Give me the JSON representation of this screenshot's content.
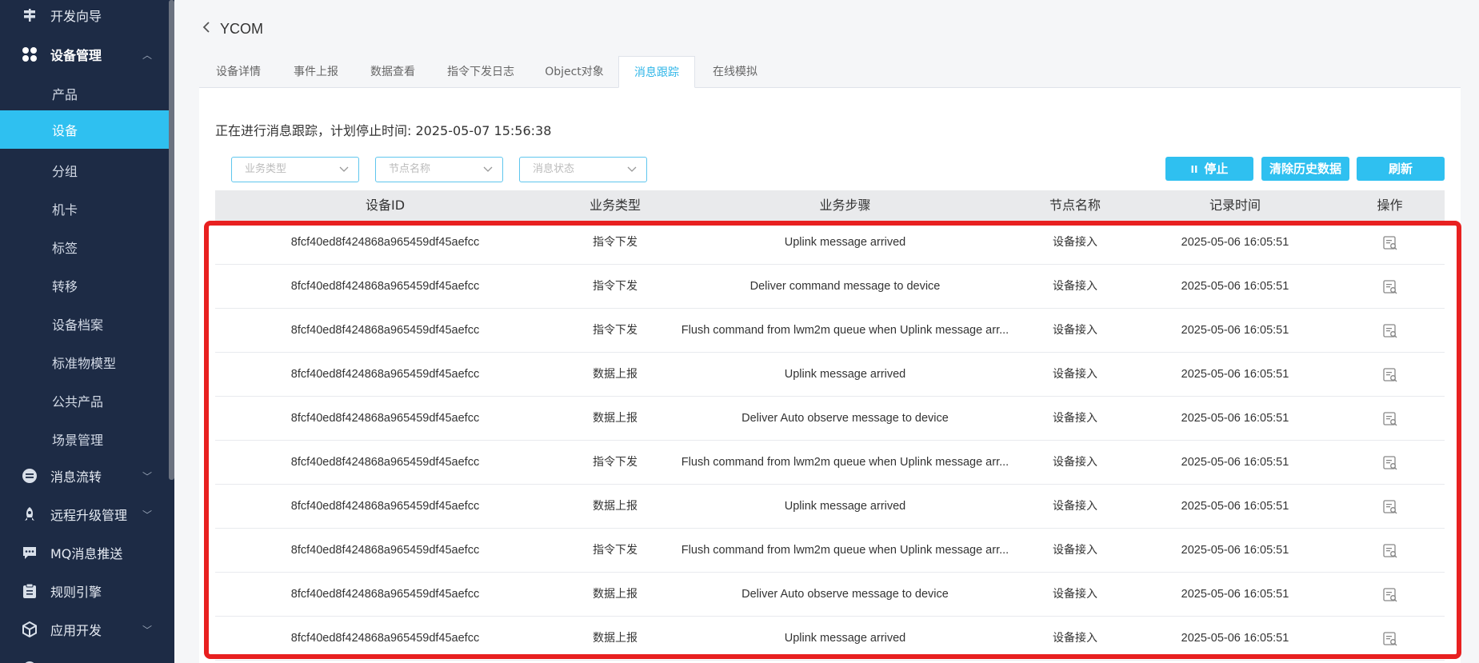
{
  "sidebar": {
    "top_items": [
      {
        "label": "开发向导",
        "icon": "signpost-icon"
      },
      {
        "label": "设备管理",
        "icon": "grid-icon",
        "expanded": true
      }
    ],
    "sub_items": [
      {
        "label": "产品"
      },
      {
        "label": "设备",
        "active": true
      },
      {
        "label": "分组"
      },
      {
        "label": "机卡"
      },
      {
        "label": "标签"
      },
      {
        "label": "转移"
      },
      {
        "label": "设备档案"
      },
      {
        "label": "标准物模型"
      },
      {
        "label": "公共产品"
      },
      {
        "label": "场景管理"
      }
    ],
    "bottom_items": [
      {
        "label": "消息流转",
        "icon": "message-flow-icon",
        "has_chevron": true
      },
      {
        "label": "远程升级管理",
        "icon": "rocket-icon",
        "has_chevron": true
      },
      {
        "label": "MQ消息推送",
        "icon": "chat-icon",
        "has_chevron": false
      },
      {
        "label": "规则引擎",
        "icon": "clipboard-icon",
        "has_chevron": false
      },
      {
        "label": "应用开发",
        "icon": "cube-icon",
        "has_chevron": true
      }
    ]
  },
  "header": {
    "title": "YCOM"
  },
  "tabs": [
    {
      "label": "设备详情"
    },
    {
      "label": "事件上报"
    },
    {
      "label": "数据查看"
    },
    {
      "label": "指令下发日志"
    },
    {
      "label": "Object对象"
    },
    {
      "label": "消息跟踪",
      "active": true
    },
    {
      "label": "在线模拟"
    }
  ],
  "status_text": "正在进行消息跟踪，计划停止时间: 2025-05-07 15:56:38",
  "filters": [
    {
      "placeholder": "业务类型"
    },
    {
      "placeholder": "节点名称"
    },
    {
      "placeholder": "消息状态"
    }
  ],
  "buttons": {
    "stop": "停止",
    "stop_icon": "II",
    "clear": "清除历史数据",
    "refresh": "刷新"
  },
  "table": {
    "columns": [
      "设备ID",
      "业务类型",
      "业务步骤",
      "节点名称",
      "记录时间",
      "操作"
    ],
    "rows": [
      {
        "device_id": "8fcf40ed8f424868a965459df45aefcc",
        "type": "指令下发",
        "step": "Uplink message arrived",
        "node": "设备接入",
        "time": "2025-05-06 16:05:51"
      },
      {
        "device_id": "8fcf40ed8f424868a965459df45aefcc",
        "type": "指令下发",
        "step": "Deliver command message to device",
        "node": "设备接入",
        "time": "2025-05-06 16:05:51"
      },
      {
        "device_id": "8fcf40ed8f424868a965459df45aefcc",
        "type": "指令下发",
        "step": "Flush command from lwm2m queue when Uplink message arr...",
        "node": "设备接入",
        "time": "2025-05-06 16:05:51"
      },
      {
        "device_id": "8fcf40ed8f424868a965459df45aefcc",
        "type": "数据上报",
        "step": "Uplink message arrived",
        "node": "设备接入",
        "time": "2025-05-06 16:05:51"
      },
      {
        "device_id": "8fcf40ed8f424868a965459df45aefcc",
        "type": "数据上报",
        "step": "Deliver Auto observe message to device",
        "node": "设备接入",
        "time": "2025-05-06 16:05:51"
      },
      {
        "device_id": "8fcf40ed8f424868a965459df45aefcc",
        "type": "指令下发",
        "step": "Flush command from lwm2m queue when Uplink message arr...",
        "node": "设备接入",
        "time": "2025-05-06 16:05:51"
      },
      {
        "device_id": "8fcf40ed8f424868a965459df45aefcc",
        "type": "数据上报",
        "step": "Uplink message arrived",
        "node": "设备接入",
        "time": "2025-05-06 16:05:51"
      },
      {
        "device_id": "8fcf40ed8f424868a965459df45aefcc",
        "type": "指令下发",
        "step": "Flush command from lwm2m queue when Uplink message arr...",
        "node": "设备接入",
        "time": "2025-05-06 16:05:51"
      },
      {
        "device_id": "8fcf40ed8f424868a965459df45aefcc",
        "type": "数据上报",
        "step": "Deliver Auto observe message to device",
        "node": "设备接入",
        "time": "2025-05-06 16:05:51"
      },
      {
        "device_id": "8fcf40ed8f424868a965459df45aefcc",
        "type": "数据上报",
        "step": "Uplink message arrived",
        "node": "设备接入",
        "time": "2025-05-06 16:05:51"
      }
    ]
  },
  "colors": {
    "accent": "#2fc0f0",
    "sidebar_bg": "#1d2b45",
    "highlight": "#e82020"
  }
}
